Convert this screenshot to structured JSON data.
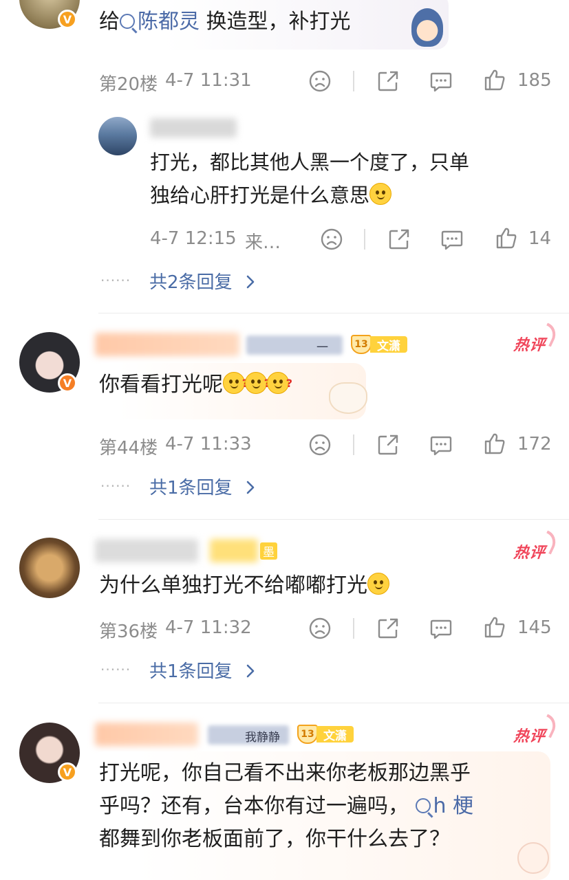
{
  "comments": [
    {
      "text_parts": [
        "给",
        "陈都灵",
        " 换造型，补打光"
      ],
      "floor": "第20楼",
      "time": "4-7 11:31",
      "likes": "185",
      "sub_reply": {
        "text_line1": "打光，都比其他人黑一个度了，只单",
        "text_line2": "独给心肝打光是什么意思",
        "time": "4-7 12:15",
        "source": "来…",
        "likes": "14"
      },
      "replies_label": "共2条回复"
    },
    {
      "tag_text": "一",
      "level": "13",
      "level_label": "文潇",
      "hot_label": "热评",
      "text": "你看看打光呢",
      "floor": "第44楼",
      "time": "4-7 11:33",
      "likes": "172",
      "replies_label": "共1条回复"
    },
    {
      "tag_text": "墨",
      "hot_label": "热评",
      "text": "为什么单独打光不给嘟嘟打光",
      "floor": "第36楼",
      "time": "4-7 11:32",
      "likes": "145",
      "replies_label": "共1条回复"
    },
    {
      "tag_text": "我静静",
      "level": "13",
      "level_label": "文潇",
      "hot_label": "热评",
      "text_line1": "打光呢，你自己看不出来你老板那边黑乎",
      "text_line2": "乎吗？还有，台本你有过一遍吗，",
      "link_text": "h 梗",
      "text_line3": "都舞到你老板面前了，你干什么去了？"
    }
  ],
  "more_dots": "······",
  "icons": {
    "dislike": "dislike-face-icon",
    "share": "share-icon",
    "comment": "comment-icon",
    "like": "thumbs-up-icon",
    "chevron": "chevron-right-icon",
    "verified": "verified-v-icon",
    "search_link": "search-link-icon"
  },
  "colors": {
    "link": "#4b6aa7",
    "meta": "#8c8c8c",
    "hot": "#f0455a",
    "badge": "#f7a020"
  }
}
